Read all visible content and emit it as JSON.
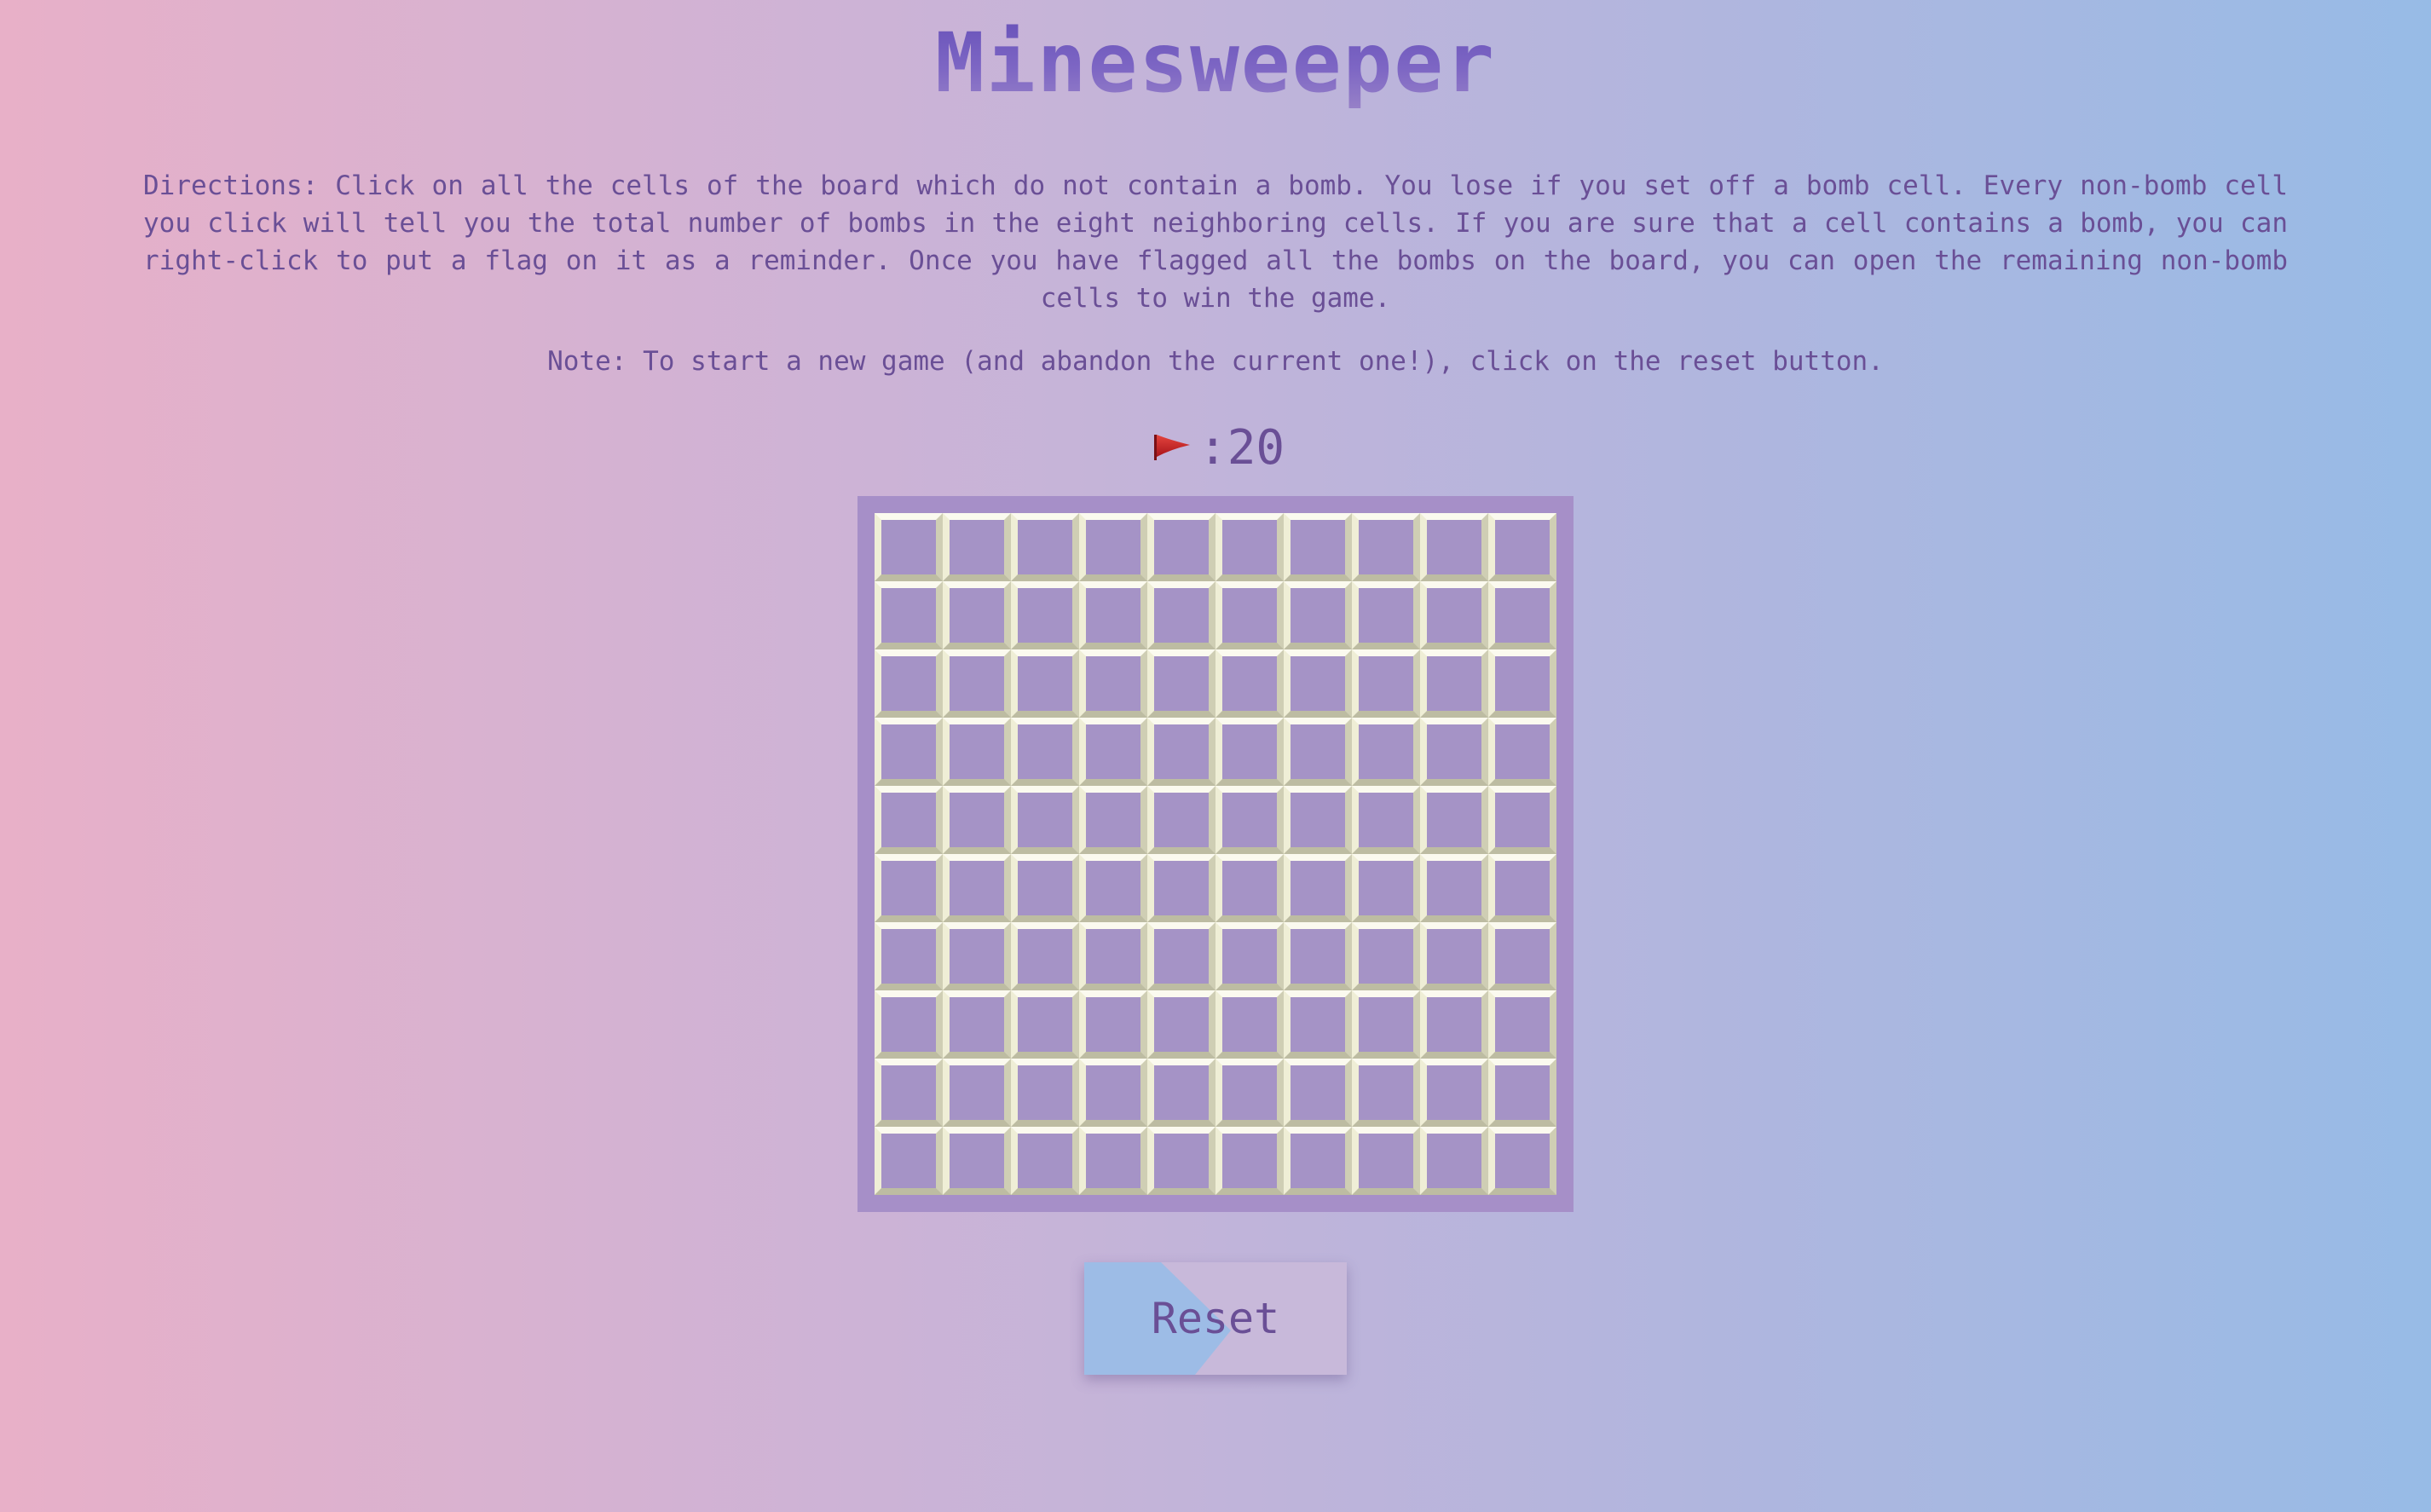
{
  "page": {
    "title": "Minesweeper",
    "directions": "Directions: Click on all the cells of the board which do not contain a bomb. You lose if you set off a bomb cell. Every non-bomb cell you click will tell you the total number of bombs in the eight neighboring cells. If you are sure that a cell contains a bomb, you can right-click to put a flag on it as a reminder. Once you have flagged all the bombs on the board, you can open the remaining non-bomb cells to win the game.",
    "note": "Note: To start a new game (and abandon the current one!), click on the reset button."
  },
  "flags": {
    "separator": ":",
    "count": "20",
    "icon": "flag-icon"
  },
  "board": {
    "rows": 10,
    "cols": 10,
    "cell_state": "unopened"
  },
  "reset": {
    "label": "Reset"
  },
  "colors": {
    "text": "#6a4f96",
    "board_bg": "#a68fc8",
    "cell_face": "#a593c6",
    "cell_highlight": "#fbfaef",
    "cell_shadow": "#bdbca2",
    "reset_bg": "#c8b9da",
    "reset_accent": "#9dbce6",
    "flag": "#d0282c"
  }
}
